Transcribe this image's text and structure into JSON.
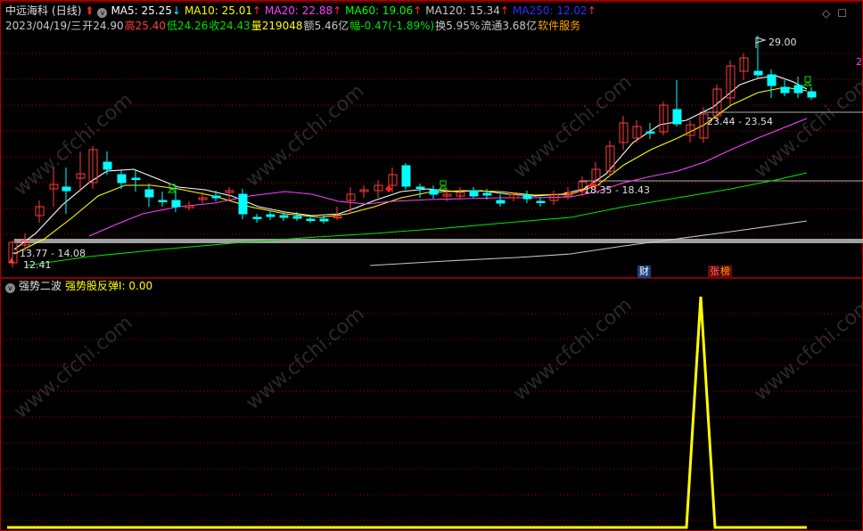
{
  "header": {
    "stock_name": "中远海科",
    "period": "(日线)",
    "ma5": {
      "label": "MA5: 25.25",
      "color": "#ffffff",
      "arrow": "↓"
    },
    "ma10": {
      "label": "MA10: 25.01",
      "color": "#ffff00",
      "arrow": "↑"
    },
    "ma20": {
      "label": "MA20: 22.88",
      "color": "#ff40ff",
      "arrow": "↑"
    },
    "ma60": {
      "label": "MA60: 19.06",
      "color": "#00ff00",
      "arrow": "↑"
    },
    "ma120": {
      "label": "MA120: 15.34",
      "color": "#c8c8c8",
      "arrow": "↑"
    },
    "ma250": {
      "label": "MA250: 12.02",
      "color": "#3030ff",
      "arrow": "↑"
    }
  },
  "quote": {
    "date": "2023/04/19/三",
    "open_label": "开",
    "open": "24.90",
    "high_label": "高",
    "high": "25.40",
    "low_label": "低",
    "low": "24.26",
    "close_label": "收",
    "close": "24.43",
    "volume_label": "量",
    "volume": "219048",
    "amount_label": "额",
    "amount": "5.46亿",
    "change_label": "幅",
    "change": "-0.47(-1.89%)",
    "turnover_label": "换",
    "turnover": "5.95%",
    "float_label": "流通",
    "float": "3.68亿",
    "sector": "软件服务"
  },
  "price_labels": {
    "high_mark": "29.00",
    "range1": "23.44 - 23.54",
    "range2": "18.35 - 18.43",
    "range3": "13.77 - 14.08",
    "low_mark": "12.41"
  },
  "badges": {
    "cai": "财",
    "zhang": "张",
    "bang": "榜"
  },
  "right_edge_label": "2",
  "indicator": {
    "name": "强势二波",
    "series_label": "强势股反弹I: 0.00",
    "color": "#ffff00"
  },
  "watermark": "www.cfchi.com",
  "colors": {
    "up": "#ff3c3c",
    "down": "#00ffff",
    "bg": "#000000",
    "border": "#b00000"
  }
}
